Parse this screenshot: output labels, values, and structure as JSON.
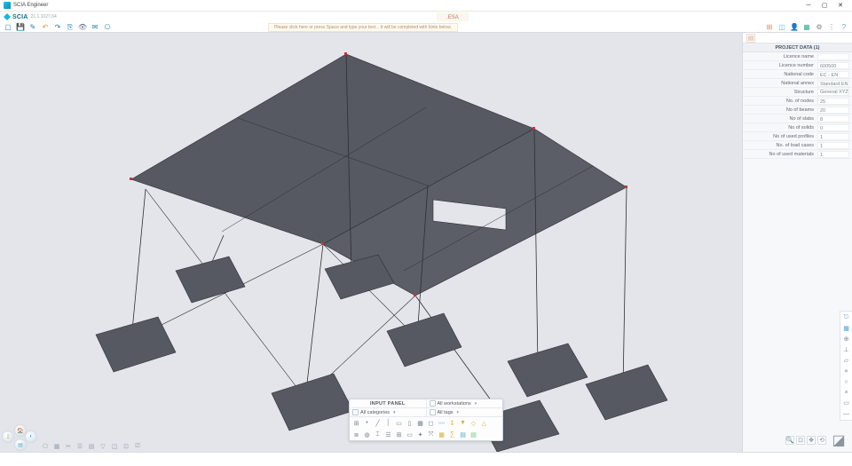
{
  "window": {
    "title": "SCIA Engineer"
  },
  "brand": {
    "name": "SCIA",
    "version": "21.1.1027.64"
  },
  "file_tab": ".ESA",
  "prompt": "Please click here or press Space and type your text... It will be completed with hints below.",
  "toolbar": {
    "new": "new-file-icon",
    "save": "save-icon",
    "sketch": "sketch-icon",
    "undo": "undo-icon",
    "redo": "redo-icon",
    "copytool": "copy-view-icon",
    "eye": "view-toggle-icon",
    "mail": "mail-icon",
    "tag": "tag-icon"
  },
  "top_right_icons": [
    {
      "name": "dashboard-icon",
      "glyph": "⊞",
      "color": "#d85"
    },
    {
      "name": "chart-icon",
      "glyph": "◫",
      "color": "#6bb"
    },
    {
      "name": "user-icon",
      "glyph": "👤",
      "color": "#5ac"
    },
    {
      "name": "cube-icon",
      "glyph": "▦",
      "color": "#4a9"
    },
    {
      "name": "gear-icon",
      "glyph": "⚙",
      "color": "#888"
    },
    {
      "name": "local-menu-icon",
      "glyph": "⋮",
      "color": "#888"
    },
    {
      "name": "help-icon",
      "glyph": "?",
      "color": "#5ac"
    }
  ],
  "properties": {
    "header": "PROJECT DATA (1)",
    "rows": [
      {
        "k": "Licence name",
        "v": ""
      },
      {
        "k": "Licence number",
        "v": "600500"
      },
      {
        "k": "National code",
        "v": "EC - EN"
      },
      {
        "k": "National annex",
        "v": "Standard EN"
      },
      {
        "k": "Structure",
        "v": "General XYZ",
        "select": true
      },
      {
        "k": "No. of nodes",
        "v": "25"
      },
      {
        "k": "No of beams",
        "v": "20"
      },
      {
        "k": "No of slabs",
        "v": "8"
      },
      {
        "k": "No of solids",
        "v": "0"
      },
      {
        "k": "No of used profiles",
        "v": "1"
      },
      {
        "k": "No. of load cases",
        "v": "1"
      },
      {
        "k": "No of used materials",
        "v": "1"
      }
    ]
  },
  "input_panel": {
    "title": "INPUT PANEL",
    "workstations": "All workstations",
    "categories": "All categories",
    "tags": "All tags",
    "row_icons_top": [
      {
        "name": "snap-grid-icon",
        "glyph": "⊞"
      },
      {
        "name": "node-icon",
        "glyph": "•"
      },
      {
        "name": "beam-icon",
        "glyph": "╱"
      },
      {
        "name": "column-icon",
        "glyph": "│"
      },
      {
        "name": "plate-icon",
        "glyph": "▭"
      },
      {
        "name": "wall-icon",
        "glyph": "▯"
      },
      {
        "name": "panel-icon",
        "glyph": "▦"
      },
      {
        "name": "opening-icon",
        "glyph": "◻"
      },
      {
        "name": "spring-icon",
        "glyph": "〰",
        "color": "#4aa6d8"
      },
      {
        "name": "load-icon",
        "glyph": "↧",
        "color": "#d8b13a"
      },
      {
        "name": "thermal-icon",
        "glyph": "▼",
        "color": "#d8b13a"
      },
      {
        "name": "hinge-icon",
        "glyph": "◇",
        "color": "#d8b13a"
      },
      {
        "name": "support-icon",
        "glyph": "△",
        "color": "#d8b13a"
      }
    ],
    "row_icons_bottom": [
      {
        "name": "layers-icon",
        "glyph": "≣"
      },
      {
        "name": "material-icon",
        "glyph": "◍"
      },
      {
        "name": "cross-section-icon",
        "glyph": "⌶"
      },
      {
        "name": "storey-icon",
        "glyph": "☰"
      },
      {
        "name": "grid-icon",
        "glyph": "⊞"
      },
      {
        "name": "selection-icon",
        "glyph": "▭"
      },
      {
        "name": "lcs-icon",
        "glyph": "✦"
      },
      {
        "name": "ucs-icon",
        "glyph": "⤧"
      },
      {
        "name": "mesh-icon",
        "glyph": "▦",
        "color": "#d8b13a"
      },
      {
        "name": "calc-icon",
        "glyph": "∑",
        "color": "#d8b13a"
      },
      {
        "name": "result-icon",
        "glyph": "▤",
        "color": "#4aa6d8"
      },
      {
        "name": "report-icon",
        "glyph": "▤",
        "color": "#6ec36e"
      }
    ]
  },
  "bl_bubbles": [
    {
      "name": "sphere-model",
      "glyph": "🏠",
      "color": "#d85",
      "pos": [
        15,
        2
      ]
    },
    {
      "name": "sphere-load",
      "glyph": "↧",
      "color": "#d8b13a",
      "pos": [
        1,
        9
      ]
    },
    {
      "name": "sphere-view",
      "glyph": "◐",
      "color": "#4aa6d8",
      "pos": [
        27,
        9
      ]
    },
    {
      "name": "sphere-result",
      "glyph": "▤",
      "color": "#5ac",
      "pos": [
        15,
        18
      ]
    }
  ],
  "btm_strip": [
    {
      "name": "check-struct-icon",
      "glyph": "⎔"
    },
    {
      "name": "mesh2-icon",
      "glyph": "▦"
    },
    {
      "name": "clip-icon",
      "glyph": "✂"
    },
    {
      "name": "act-layer-icon",
      "glyph": "☰"
    },
    {
      "name": "storey2-icon",
      "glyph": "▤"
    },
    {
      "name": "filter-icon",
      "glyph": "▽"
    },
    {
      "name": "view-env-icon",
      "glyph": "◫"
    },
    {
      "name": "wire-icon",
      "glyph": "⊡"
    },
    {
      "name": "label-icon",
      "glyph": "⎚"
    }
  ],
  "vrail": [
    {
      "name": "vr-snap-icon",
      "glyph": "⎋",
      "color": "#4aa6d8"
    },
    {
      "name": "vr-grid-icon",
      "glyph": "▦",
      "color": "#4aa6d8"
    },
    {
      "name": "vr-track-icon",
      "glyph": "⊕"
    },
    {
      "name": "vr-ortho-icon",
      "glyph": "⊥"
    },
    {
      "name": "vr-plane-icon",
      "glyph": "▱"
    },
    {
      "name": "vr-mid-icon",
      "glyph": "⋄"
    },
    {
      "name": "vr-end-icon",
      "glyph": "○"
    },
    {
      "name": "vr-int-icon",
      "glyph": "×"
    },
    {
      "name": "vr-surf-icon",
      "glyph": "▭"
    },
    {
      "name": "vr-line-icon",
      "glyph": "—"
    }
  ],
  "br_view_icons": [
    {
      "name": "zoom-all-icon",
      "glyph": "🔍"
    },
    {
      "name": "zoom-window-icon",
      "glyph": "⊡"
    },
    {
      "name": "pan-icon",
      "glyph": "✥"
    },
    {
      "name": "rotate-icon",
      "glyph": "⟲"
    }
  ]
}
